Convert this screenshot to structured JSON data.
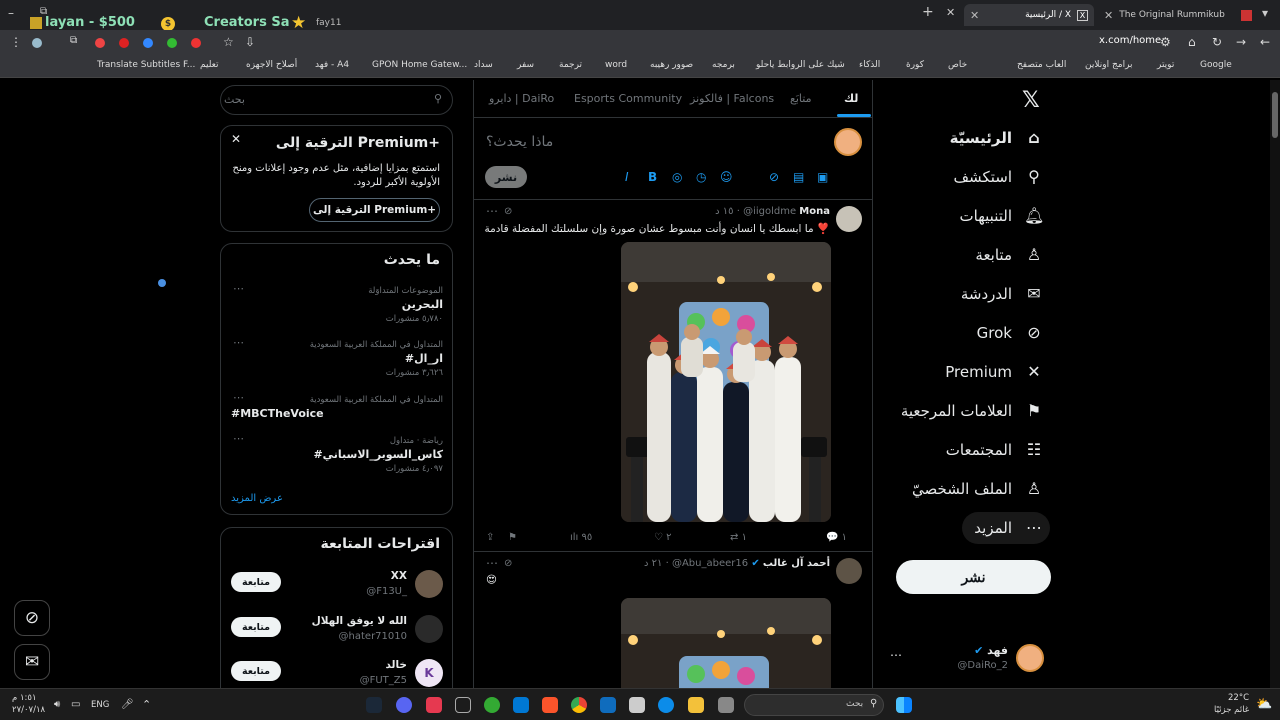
{
  "browser": {
    "top_left_tag": "fay11",
    "promo_left": "layan - $500",
    "promo_right": "Creators Sa -",
    "tabs": [
      {
        "title": "الرئيسية / X",
        "active": true
      },
      {
        "title": "The Original Rummikub",
        "active": false
      }
    ],
    "url": "x.com/home",
    "bookmarks": [
      "Google",
      "تويتر",
      "برامج اونلاين",
      "العاب متصفح",
      "خاص",
      "كورة",
      "الذكاء",
      "شيك على الروابط ياحلو",
      "برمجه",
      "صوور رهيبه",
      "word",
      "ترجمة",
      "سفر",
      "سداد",
      "GPON Home Gatew...",
      "فهد - A4",
      "أصلاح الاجهزه",
      "تعليم",
      "Translate Subtitles F..."
    ]
  },
  "nav": {
    "items": [
      {
        "label": "الرئيسيّة",
        "icon": "home-icon",
        "glyph": "⌂",
        "active": true
      },
      {
        "label": "استكشف",
        "icon": "search-icon",
        "glyph": "⚲",
        "active": false
      },
      {
        "label": "التنبيهات",
        "icon": "bell-icon",
        "glyph": "♫",
        "active": false
      },
      {
        "label": "متابعة",
        "icon": "follow-icon",
        "glyph": "♙",
        "active": false
      },
      {
        "label": "الدردشة",
        "icon": "mail-icon",
        "glyph": "✉",
        "active": false
      },
      {
        "label": "Grok",
        "icon": "grok-icon",
        "glyph": "⊘",
        "active": false
      },
      {
        "label": "Premium",
        "icon": "x-icon",
        "glyph": "✕",
        "active": false
      },
      {
        "label": "العلامات المرجعية",
        "icon": "bookmark-icon",
        "glyph": "⚑",
        "active": false
      },
      {
        "label": "المجتمعات",
        "icon": "communities-icon",
        "glyph": "☷",
        "active": false
      },
      {
        "label": "الملف الشخصيّ",
        "icon": "profile-icon",
        "glyph": "♙",
        "active": false
      },
      {
        "label": "المزيد",
        "icon": "more-icon",
        "glyph": "⋯",
        "active": false
      }
    ],
    "post_button": "نشر",
    "account": {
      "name": "فهد",
      "handle": "@DaiRo_2"
    }
  },
  "feed": {
    "tabs": [
      "لك",
      "متابَع",
      "فالكونز | Falcons",
      "Esports Community",
      "دايرو | DaiRo"
    ],
    "compose_placeholder": "ماذا يحدث؟",
    "compose_button": "نشر",
    "tweets": [
      {
        "name": "Mona",
        "handle": "@iigoldme",
        "time": "١٥ د",
        "text": "ما ابسطك يا انسان وأنت مبسوط عشان صورة وإن  سلسلتك المفضلة قادمة ❣️",
        "replies": "١",
        "retweets": "١",
        "likes": "٢",
        "views": "٩٥"
      },
      {
        "name": "أحمد آل غالب",
        "handle": "@Abu_abeer16",
        "time": "٢١ د",
        "text": "😍",
        "replies": "",
        "retweets": "",
        "likes": "",
        "views": ""
      }
    ]
  },
  "sidebar": {
    "search_placeholder": "بحث",
    "premium": {
      "title": "الترقية إلى Premium+",
      "description": "استمتع بمزايا إضافية، مثل عدم وجود إعلانات ومنح الأولوية الأكبر للردود.",
      "button": "الترقية إلى Premium+"
    },
    "trends_title": "ما يحدث",
    "trends": [
      {
        "category": "الموضوعات المتداوَلة",
        "name": "البحرين",
        "count": "٥٫٧٨٠ منشورات"
      },
      {
        "category": "المتداول في المملكة العربية السعودية",
        "name": "#ار_ال",
        "count": "٣٫٦٢٦ منشورات"
      },
      {
        "category": "المتداول في المملكة العربية السعودية",
        "name": "#MBCTheVoice",
        "count": ""
      },
      {
        "category": "رياضة · متداول",
        "name": "#كاس_السوبر_الاسباني",
        "count": "٤٫٠٩٧ منشورات"
      }
    ],
    "show_more": "عرض المزيد",
    "wtf_title": "اقتراحات المتابعة",
    "wtf": [
      {
        "name": "XX",
        "handle": "@F13U_",
        "button": "متابعة"
      },
      {
        "name": "الله لا يوفق الهلال",
        "handle": "@hater71010",
        "button": "متابعة"
      },
      {
        "name": "خالد",
        "handle": "@FUT_Z5",
        "button": "متابعة"
      }
    ]
  },
  "taskbar": {
    "search_placeholder": "بحث",
    "lang": "ENG",
    "weather_temp": "22°C",
    "weather_desc": "غائم جزئيًا",
    "time": "١:٥١ م",
    "date": "٢٧/٠٧/١٨"
  },
  "colors": {
    "accent": "#1d9bf0",
    "background": "#000000",
    "border": "#2f3336",
    "muted": "#71767b"
  }
}
